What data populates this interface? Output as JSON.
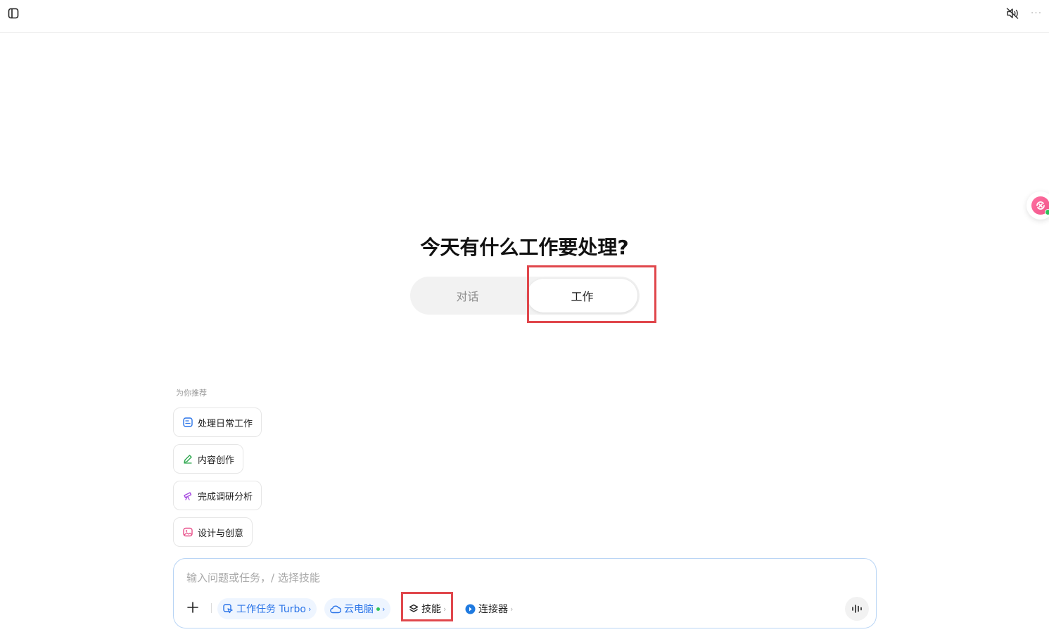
{
  "topbar": {
    "sidebar_icon": "sidebar-toggle-icon",
    "mute_icon": "mute-icon",
    "more_label": "···"
  },
  "main": {
    "headline": "今天有什么工作要处理?",
    "mode_tabs": [
      {
        "label": "对话",
        "selected": false
      },
      {
        "label": "工作",
        "selected": true
      }
    ]
  },
  "recommendations": {
    "label": "为你推荐",
    "items": [
      {
        "label": "处理日常工作",
        "icon": "document-icon",
        "color": "#2a74e8"
      },
      {
        "label": "内容创作",
        "icon": "pen-icon",
        "color": "#2fa84f"
      },
      {
        "label": "完成调研分析",
        "icon": "telescope-icon",
        "color": "#a64be0"
      },
      {
        "label": "设计与创意",
        "icon": "image-icon",
        "color": "#e8508a"
      }
    ]
  },
  "composer": {
    "placeholder": "输入问题或任务，/ 选择技能",
    "tools": {
      "turbo_label": "工作任务 Turbo",
      "cloud_label": "云电脑",
      "skill_label": "技能",
      "connector_label": "连接器",
      "chevron": "›"
    }
  },
  "colors": {
    "accent": "#2a74e8",
    "highlight": "#e0474c",
    "online": "#2fc25b"
  }
}
